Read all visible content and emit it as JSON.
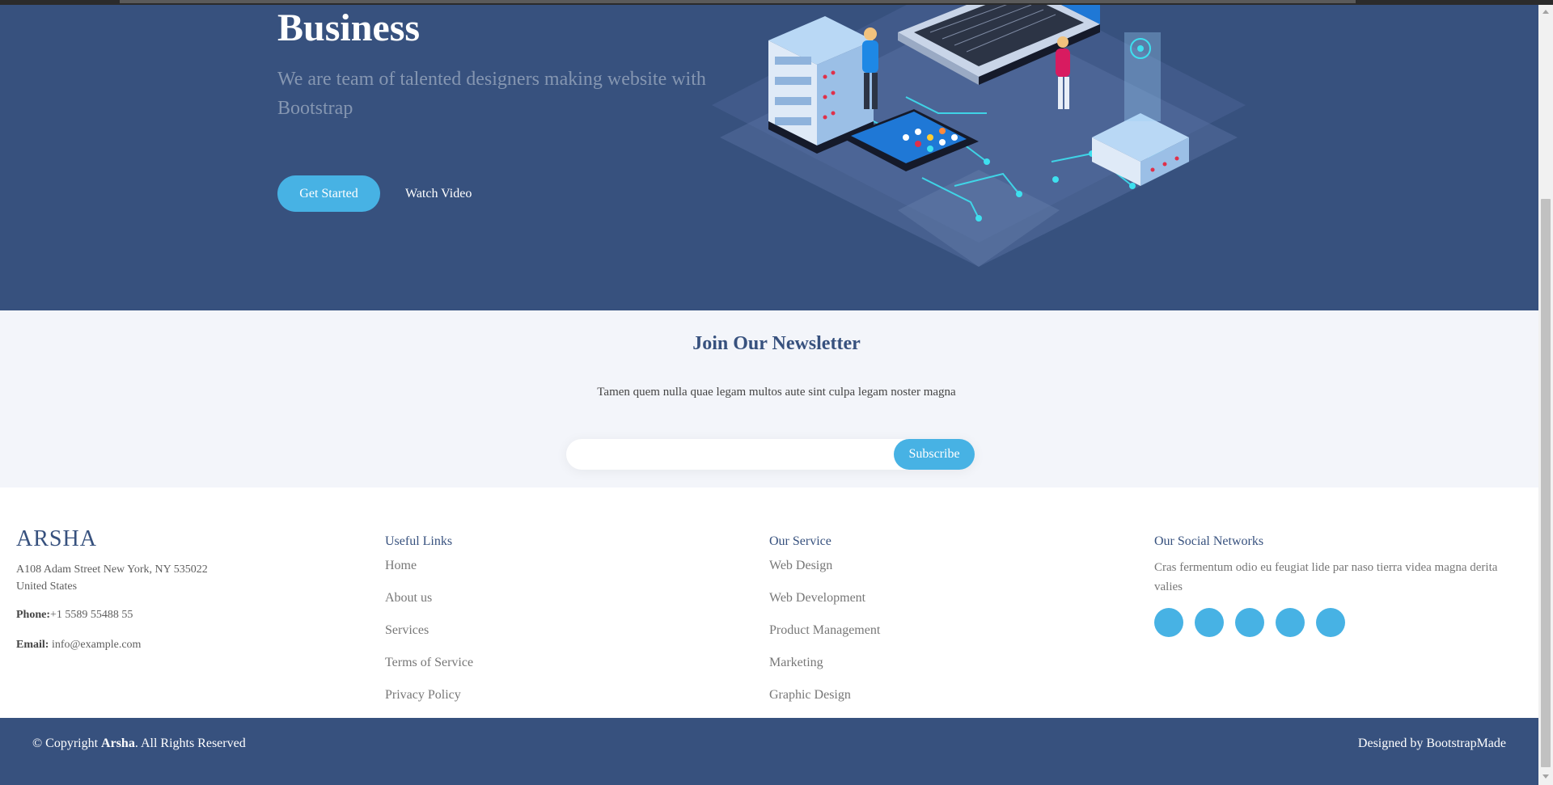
{
  "hero": {
    "title": "Business",
    "subtitle": "We are team of talented designers making website with Bootstrap",
    "get_started_label": "Get Started",
    "watch_video_label": "Watch Video"
  },
  "newsletter": {
    "title": "Join Our Newsletter",
    "text": "Tamen quem nulla quae legam multos aute sint culpa legam noster magna",
    "input_value": "",
    "subscribe_label": "Subscribe"
  },
  "footer": {
    "logo": "ARSHA",
    "address_line1": "A108 Adam Street New York, NY 535022",
    "address_line2": "United States",
    "phone_label": "Phone:",
    "phone": "+1 5589 55488 55",
    "email_label": "Email:",
    "email": "info@example.com",
    "useful_links": {
      "heading": "Useful Links",
      "items": [
        "Home",
        "About us",
        "Services",
        "Terms of Service",
        "Privacy Policy"
      ]
    },
    "services": {
      "heading": "Our Service",
      "items": [
        "Web Design",
        "Web Development",
        "Product Management",
        "Marketing",
        "Graphic Design"
      ]
    },
    "social": {
      "heading": "Our Social Networks",
      "text": "Cras fermentum odio eu feugiat lide par naso tierra videa magna derita valies",
      "icons": [
        "twitter-icon",
        "facebook-icon",
        "instagram-icon",
        "skype-icon",
        "linkedin-icon"
      ]
    }
  },
  "bottom": {
    "copyright_prefix": "© Copyright ",
    "copyright_brand": "Arsha",
    "copyright_suffix": ". All Rights Reserved",
    "credits_prefix": "Designed by ",
    "credits_link": "BootstrapMade"
  },
  "colors": {
    "primary": "#37517e",
    "accent": "#47b2e4",
    "light_bg": "#f3f5fa"
  }
}
